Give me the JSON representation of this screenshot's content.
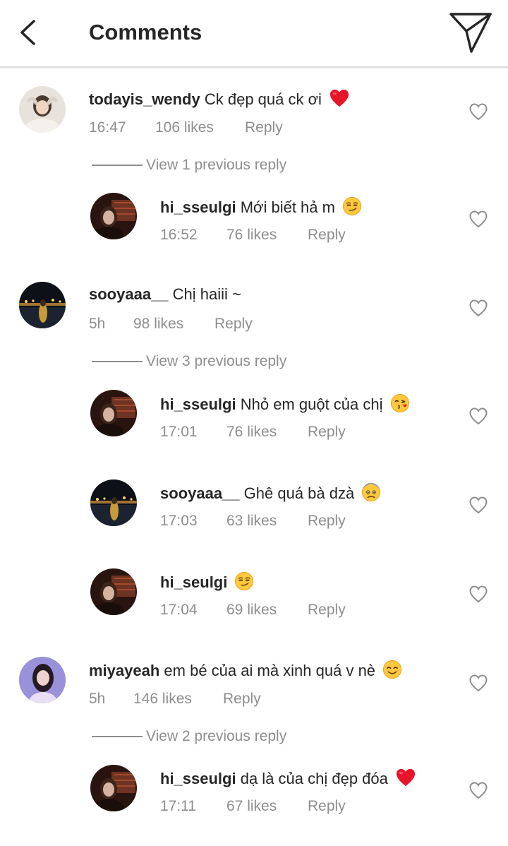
{
  "header": {
    "title": "Comments",
    "back_icon": "chevron-left-icon",
    "direct_icon": "paper-plane-icon"
  },
  "comments": [
    {
      "username": "todayis_wendy",
      "text": "Ck đẹp quá ck ơi",
      "emoji": "red-heart",
      "time": "16:47",
      "likes": "106 likes",
      "reply": "Reply",
      "view_replies": "View 1 previous reply",
      "replies": [
        {
          "username": "hi_sseulgi",
          "text": "Mới biết hả m",
          "emoji": "smirking-face",
          "time": "16:52",
          "likes": "76 likes",
          "reply": "Reply"
        }
      ]
    },
    {
      "username": "sooyaaa__",
      "text": "Chị haiii ~",
      "time": "5h",
      "likes": "98 likes",
      "reply": "Reply",
      "view_replies": "View 3 previous reply",
      "replies": [
        {
          "username": "hi_sseulgi",
          "text": "Nhỏ em guột của chị",
          "emoji": "face-blowing-kiss",
          "time": "17:01",
          "likes": "76 likes",
          "reply": "Reply"
        },
        {
          "username": "sooyaaa__",
          "text": "Ghê quá bà dzà",
          "emoji": "anxious-face",
          "time": "17:03",
          "likes": "63 likes",
          "reply": "Reply"
        },
        {
          "username": "hi_seulgi",
          "text": "",
          "emoji": "smirking-face",
          "time": "17:04",
          "likes": "69 likes",
          "reply": "Reply"
        }
      ]
    },
    {
      "username": "miyayeah",
      "text": "em bé của ai mà xinh quá v nè",
      "emoji": "smiling-face",
      "time": "5h",
      "likes": "146 likes",
      "reply": "Reply",
      "view_replies": "View 2 previous reply",
      "replies": [
        {
          "username": "hi_sseulgi",
          "text": "dạ là của chị đẹp đóa",
          "emoji": "red-heart",
          "time": "17:11",
          "likes": "67 likes",
          "reply": "Reply"
        }
      ]
    }
  ],
  "colors": {
    "text": "#262626",
    "secondary": "#8e8e8e",
    "divider": "#dbdbdb",
    "heart_red": "#ed1c24",
    "emoji_yellow": "#ffc83d"
  }
}
